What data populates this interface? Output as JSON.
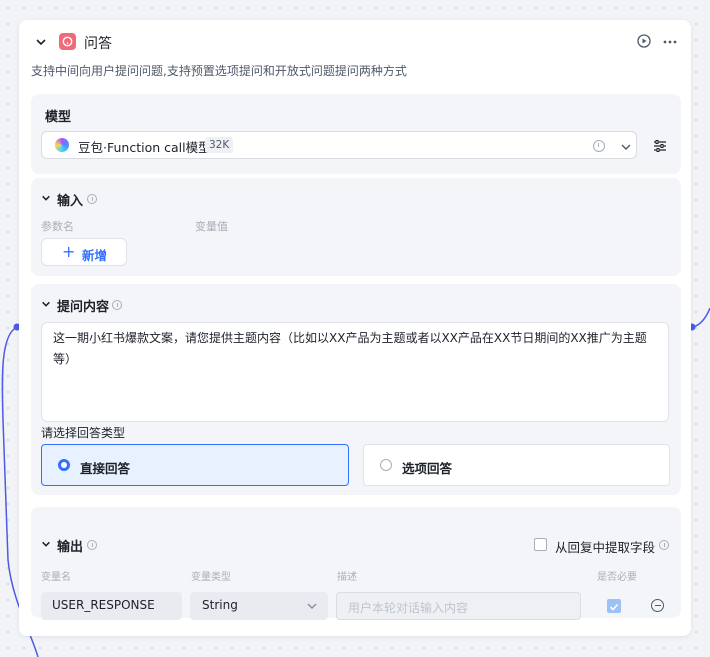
{
  "node": {
    "title": "问答",
    "description": "支持中间向用户提问问题,支持预置选项提问和开放式问题提问两种方式"
  },
  "model": {
    "section_title": "模型",
    "name": "豆包·Function call模型",
    "context_tag": "32K"
  },
  "input": {
    "section_title": "输入",
    "col_param_name": "参数名",
    "col_var_value": "变量值",
    "add_label": "新增"
  },
  "question": {
    "section_title": "提问内容",
    "content": "这一期小红书爆款文案，请您提供主题内容（比如以XX产品为主题或者以XX产品在XX节日期间的XX推广为主题等）",
    "answer_type_label": "请选择回答类型",
    "options": [
      {
        "label": "直接回答",
        "selected": true
      },
      {
        "label": "选项回答",
        "selected": false
      }
    ]
  },
  "output": {
    "section_title": "输出",
    "extract_label": "从回复中提取字段",
    "extract_checked": false,
    "col_var_name": "变量名",
    "col_var_type": "变量类型",
    "col_desc": "描述",
    "col_required": "是否必要",
    "row": {
      "name": "USER_RESPONSE",
      "type": "String",
      "desc_placeholder": "用户本轮对话输入内容",
      "required": true
    }
  },
  "icons": {
    "collapse": "chevron-down-icon",
    "node": "question-icon",
    "run": "play-icon",
    "more": "more-icon",
    "info": "info-icon",
    "model": "doubao-logo-icon",
    "settings": "settings-sliders-icon",
    "add": "plus-icon",
    "remove": "minus-circle-icon"
  },
  "colors": {
    "accent": "#3370ff",
    "node_icon": "#f06b7a",
    "edge": "#4d5be6"
  }
}
